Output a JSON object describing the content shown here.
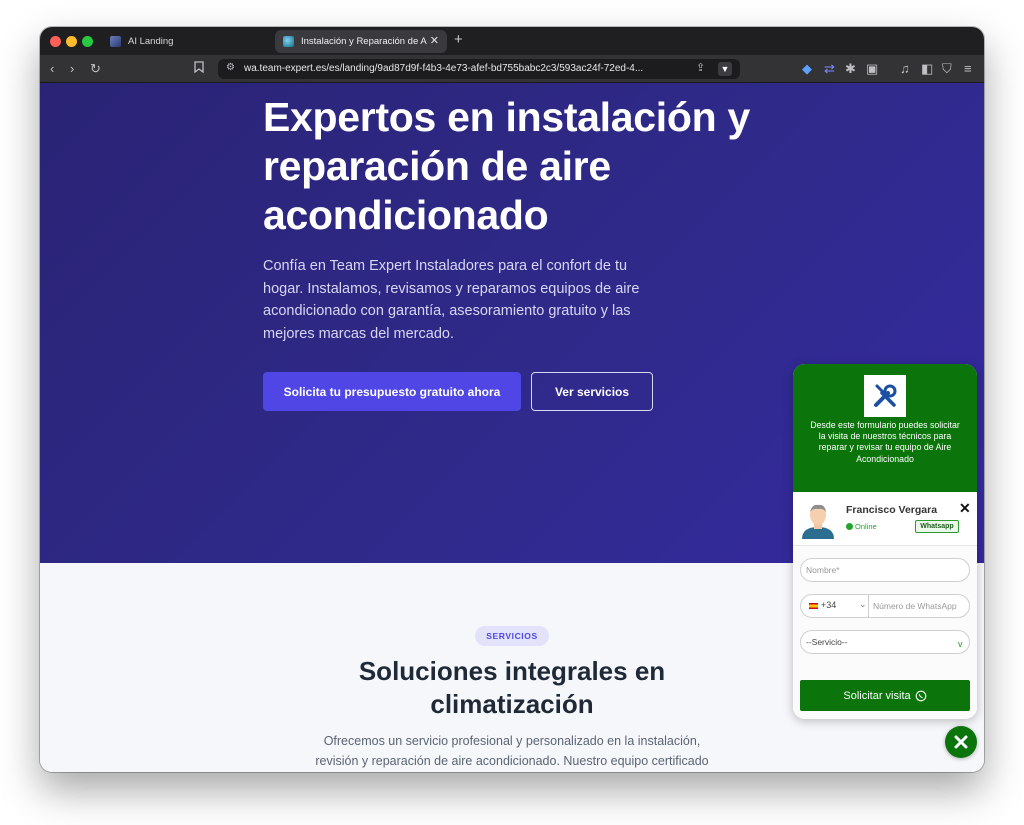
{
  "browser": {
    "tabs": [
      {
        "title": "AI Landing",
        "active": false
      },
      {
        "title": "Instalación y Reparación de Aire",
        "active": true
      }
    ],
    "url": "wa.team-expert.es/es/landing/9ad87d9f-f4b3-4e73-afef-bd755babc2c3/593ac24f-72ed-4..."
  },
  "hero": {
    "title": "Expertos en instalación y reparación de aire acondicionado",
    "description": "Confía en Team Expert Instaladores para el confort de tu hogar. Instalamos, revisamos y reparamos equipos de aire acondicionado con garantía, asesoramiento gratuito y las mejores marcas del mercado.",
    "primary_cta": "Solicita tu presupuesto gratuito ahora",
    "secondary_cta": "Ver servicios"
  },
  "services": {
    "badge": "SERVICIOS",
    "title": "Soluciones integrales en climatización",
    "description": "Ofrecemos un servicio profesional y personalizado en la instalación, revisión y reparación de aire acondicionado. Nuestro equipo certificado"
  },
  "whatsapp_widget": {
    "intro": "Desde este formulario puedes solicitar la visita de nuestros técnicos para reparar y revisar tu equipo de Aire Acondicionado",
    "agent_name": "Francisco Vergara",
    "status": "Online",
    "channel_badge": "Whatsapp",
    "name_placeholder": "Nombre*",
    "country_code": "+34",
    "phone_placeholder": "Número de WhatsApp",
    "service_select": "--Servicio--",
    "submit_label": "Solicitar visita",
    "accent_color": "#0b740b"
  },
  "colors": {
    "hero_bg": "#2f2a8a",
    "primary_button": "#5046e5",
    "whatsapp_green": "#0b740b"
  }
}
